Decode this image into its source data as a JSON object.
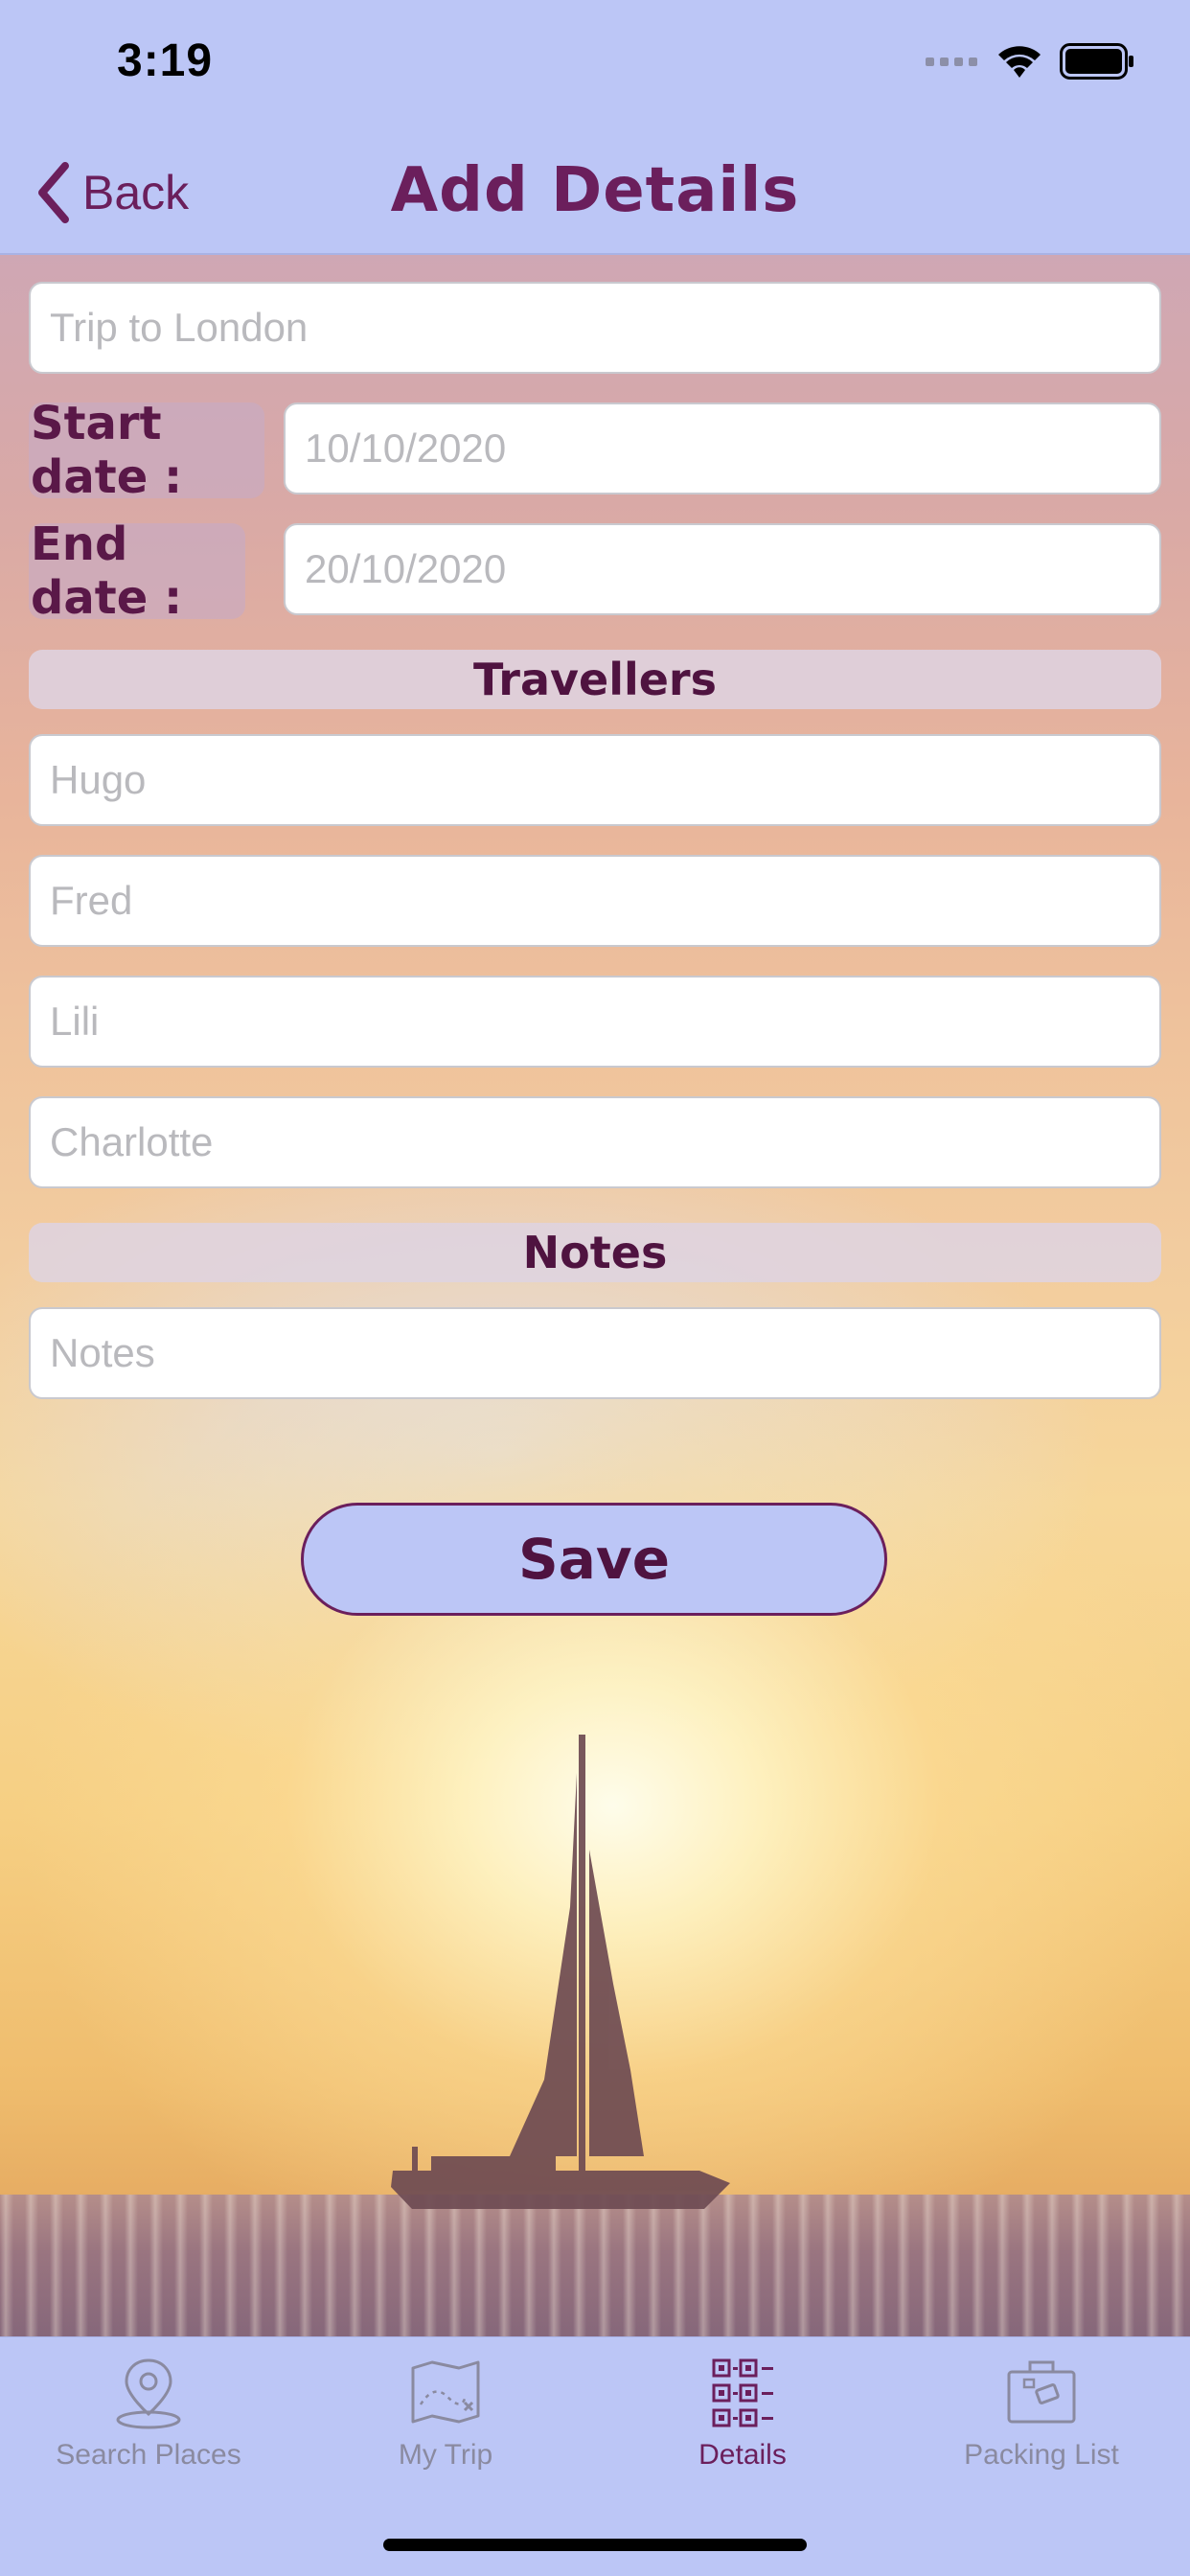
{
  "status_bar": {
    "time": "3:19"
  },
  "navbar": {
    "back_label": "Back",
    "title": "Add Details"
  },
  "form": {
    "trip_name_placeholder": "Trip to London",
    "start_date_label": "Start date :",
    "start_date_placeholder": "10/10/2020",
    "end_date_label": "End date :",
    "end_date_placeholder": "20/10/2020",
    "travellers_header": "Travellers",
    "travellers": [
      "Hugo",
      "Fred",
      "Lili",
      "Charlotte"
    ],
    "notes_header": "Notes",
    "notes_placeholder": "Notes",
    "save_label": "Save"
  },
  "tabbar": {
    "items": [
      {
        "label": "Search Places",
        "icon": "map-pin-icon",
        "active": false
      },
      {
        "label": "My Trip",
        "icon": "trip-map-icon",
        "active": false
      },
      {
        "label": "Details",
        "icon": "qr-code-icon",
        "active": true
      },
      {
        "label": "Packing List",
        "icon": "suitcase-icon",
        "active": false
      }
    ]
  },
  "colors": {
    "bar_background": "#bcc6f6",
    "accent": "#6b1f5c",
    "inactive_tab": "#8a8aa0"
  }
}
